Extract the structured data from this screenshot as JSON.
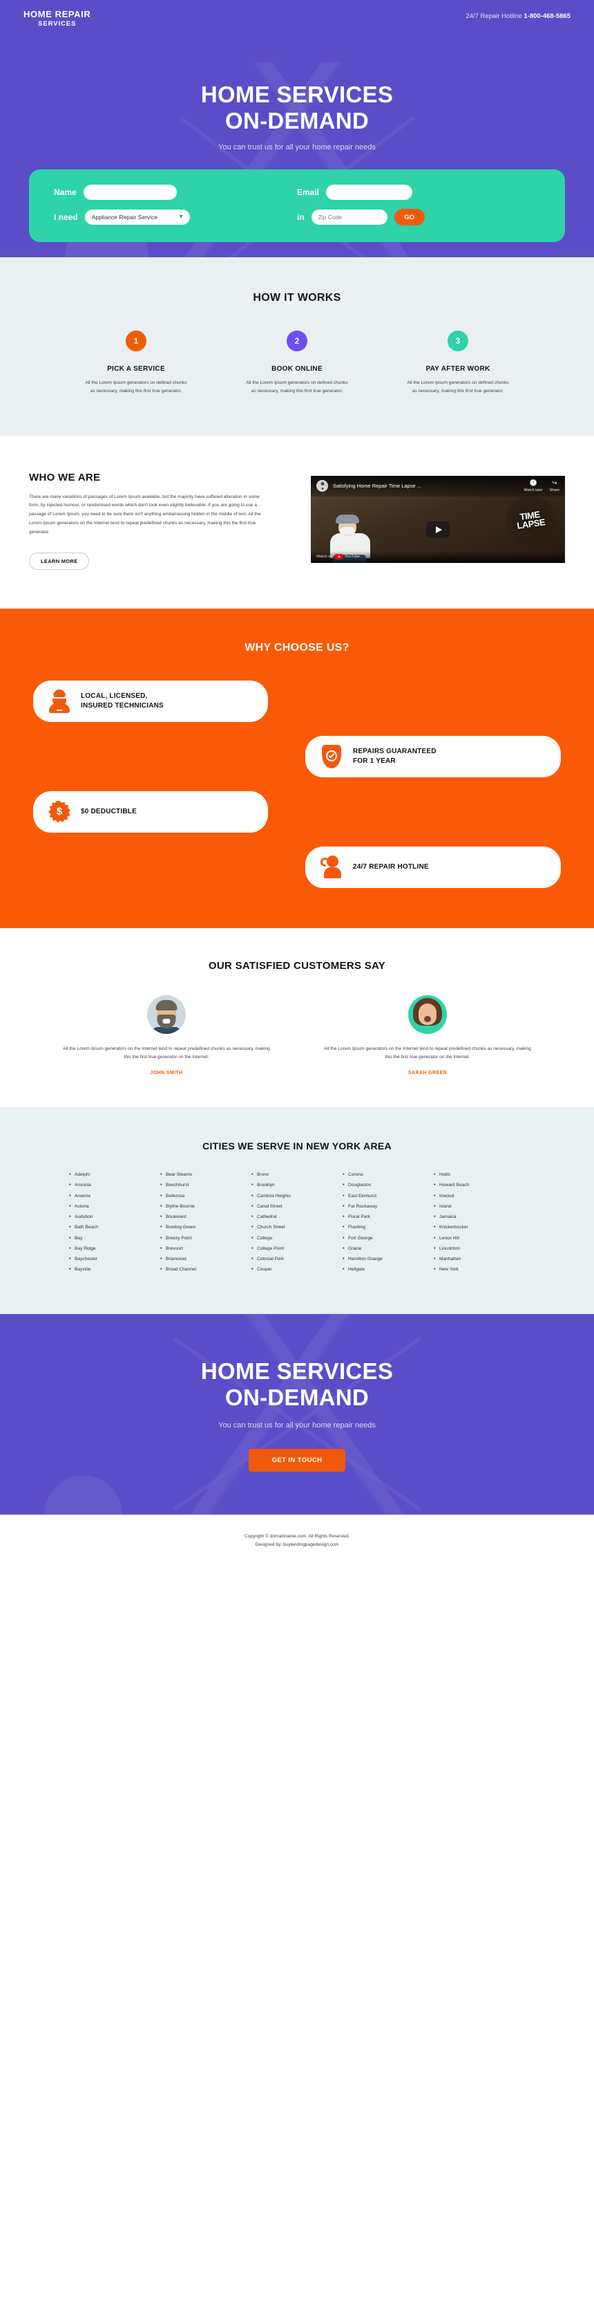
{
  "header": {
    "logo_line1": "HOME REPAIR",
    "logo_line2": "SERVICES",
    "hotline_label": "24/7 Repair Hotline ",
    "hotline_number": "1-800-468-5865"
  },
  "hero": {
    "title_line1": "HOME SERVICES",
    "title_line2": "ON-DEMAND",
    "subtitle": "You can trust us for all your home repair needs",
    "form": {
      "name_label": "Name",
      "name_value": "",
      "name_placeholder": "",
      "email_label": "Email",
      "email_value": "",
      "email_placeholder": "",
      "need_label": "I need",
      "service_selected": "Appliance Repair Service",
      "service_options": [
        "Appliance Repair Service"
      ],
      "in_label": "in",
      "zip_value": "",
      "zip_placeholder": "Zip Code",
      "submit_label": "GO"
    }
  },
  "how_it_works": {
    "title": "HOW IT WORKS",
    "steps": [
      {
        "number": "1",
        "title": "PICK A SERVICE",
        "text": "All the Lorem Ipsum generators on defined chunks as necessary, making this first true generator.",
        "color": "#f25c05"
      },
      {
        "number": "2",
        "title": "BOOK ONLINE",
        "text": "All the Lorem Ipsum generators on defined chunks as necessary, making this first true generator.",
        "color": "#6f4df0"
      },
      {
        "number": "3",
        "title": "PAY AFTER WORK",
        "text": "All the Lorem Ipsum generators on defined chunks as necessary, making this first true generator.",
        "color": "#2ed3a8"
      }
    ]
  },
  "who_we_are": {
    "title": "WHO WE ARE",
    "paragraph": "There are many variations of passages of Lorem Ipsum available, but the majority have suffered alteration in some form, by injected humour, or randomised words which don't look even slightly believable. If you are going to use a passage of Lorem Ipsum, you need to be sure there isn't anything embarrassing hidden in the middle of text. All the Lorem Ipsum generators on the Internet tend to repeat predefined chunks as necessary, making this the first true generator.",
    "button_label": "LEARN MORE",
    "video": {
      "title": "Satisfying Home Repair Time Lapse ...",
      "watch_later": "Watch later",
      "share": "Share",
      "badge_line1": "TIME",
      "badge_line2": "LAPSE",
      "watch_on": "Watch on",
      "platform": "YouTube"
    }
  },
  "why_choose_us": {
    "title": "WHY CHOOSE US?",
    "features": [
      {
        "icon": "technician-icon",
        "label": "LOCAL, LICENSED,\nINSURED TECHNICIANS",
        "line1": "LOCAL, LICENSED,",
        "line2": "INSURED TECHNICIANS"
      },
      {
        "icon": "shield-check-icon",
        "label": "REPAIRS GUARANTEED FOR 1 YEAR",
        "line1": "REPAIRS GUARANTEED",
        "line2": "FOR 1 YEAR"
      },
      {
        "icon": "dollar-burst-icon",
        "label": "$0 DEDUCTIBLE",
        "line1": "$0 DEDUCTIBLE",
        "line2": ""
      },
      {
        "icon": "phone-support-icon",
        "label": "24/7 REPAIR HOTLINE",
        "line1": "24/7 REPAIR HOTLINE",
        "line2": ""
      }
    ]
  },
  "testimonials": {
    "title": "OUR SATISFIED CUSTOMERS SAY",
    "items": [
      {
        "quote": "All the Lorem Ipsum generators on the Internet tend to repeat predefined chunks as necessary, making this the first true generator on the Internet.",
        "name": "JOHN SMITH"
      },
      {
        "quote": "All the Lorem Ipsum generators on the Internet tend to repeat predefined chunks as necessary, making this the first true generator on the Internet.",
        "name": "SARAH GREEN"
      }
    ]
  },
  "cities": {
    "title": "CITIES WE SERVE IN NEW YORK AREA",
    "columns": [
      [
        "Adelphi",
        "Ansonia",
        "Arverne",
        "Astoria",
        "Audubon",
        "Bath Beach",
        "Bay",
        "Bay Ridge",
        "Baychester",
        "Bayside"
      ],
      [
        "Bear Stearns",
        "Beechhurst",
        "Bellerose",
        "Blythe-Bourne",
        "Boulevard",
        "Bowling Green",
        "Breezy Point",
        "Brevoort",
        "Briarwood",
        "Broad Channel"
      ],
      [
        "Bronx",
        "Brooklyn",
        "Cambria Heights",
        "Canal Street",
        "Cathedral",
        "Church Street",
        "College",
        "College Point",
        "Colonial Park",
        "Cooper"
      ],
      [
        "Corona",
        "Douglaston",
        "East Elmhurst",
        "Far Rockaway",
        "Floral Park",
        "Flushing",
        "Fort George",
        "Gracie",
        "Hamilton Grange",
        "Hellgate"
      ],
      [
        "Hollis",
        "Howard Beach",
        "Inwood",
        "Island",
        "Jamaica",
        "Knickerbocker",
        "Lenox Hill",
        "Lincolnton",
        "Manhattan",
        "New York"
      ]
    ]
  },
  "cta": {
    "title_line1": "HOME SERVICES",
    "title_line2": "ON-DEMAND",
    "subtitle": "You can trust us for all your home repair needs",
    "button_label": "GET IN TOUCH"
  },
  "footer": {
    "line1": "Copyright © domainname.com. All Rights Reserved.",
    "line2": "Designed by: buylandingpagedesign.com"
  },
  "colors": {
    "purple": "#5b4dc7",
    "orange": "#fa5a05",
    "teal": "#2ed3a8",
    "light": "#eaf0f2"
  }
}
